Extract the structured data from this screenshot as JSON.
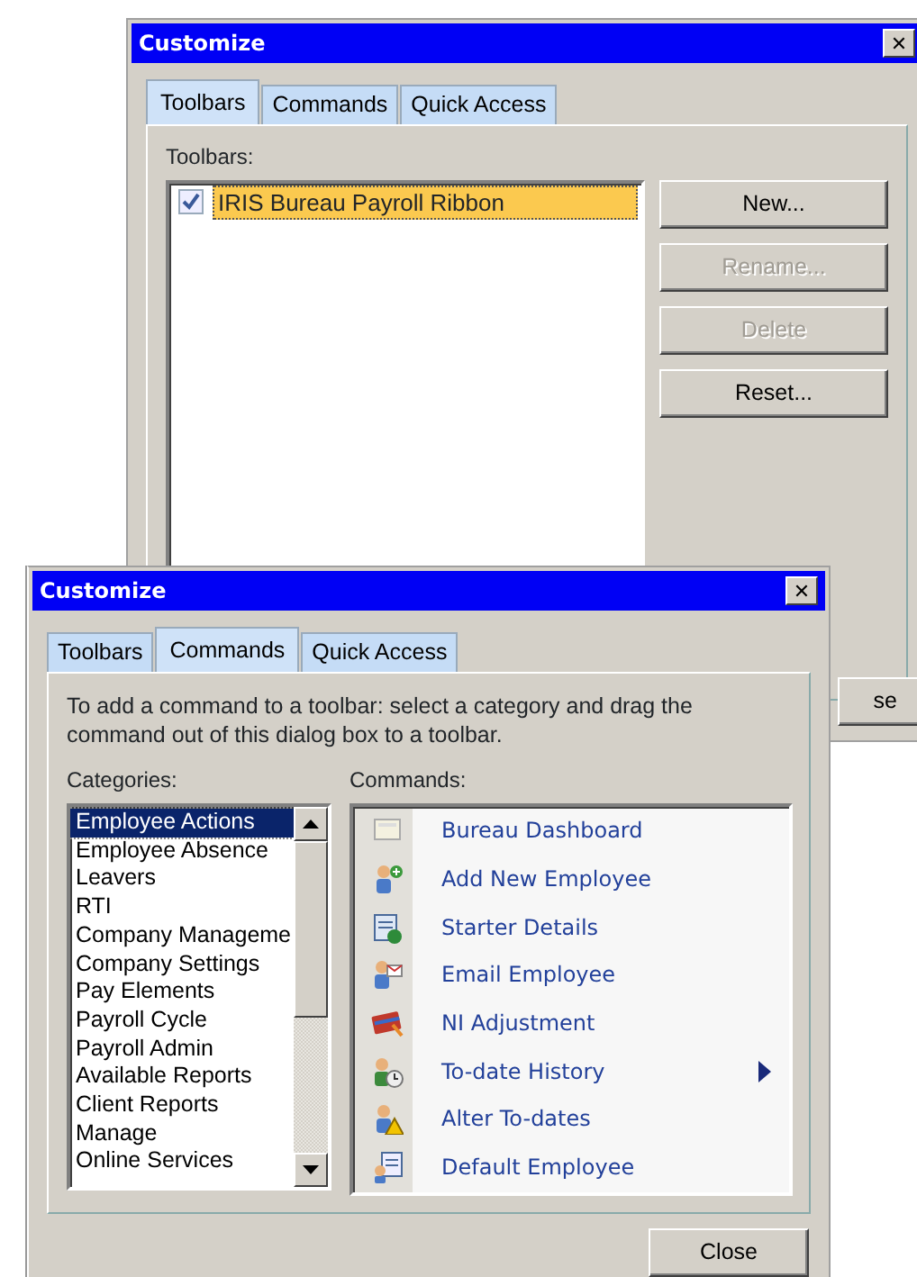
{
  "back_dialog": {
    "title": "Customize",
    "close": "✕",
    "tabs": [
      {
        "label": "Toolbars",
        "selected": true
      },
      {
        "label": "Commands",
        "selected": false
      },
      {
        "label": "Quick Access",
        "selected": false
      }
    ],
    "toolbars_label": "Toolbars:",
    "toolbars": [
      {
        "label": "IRIS Bureau Payroll Ribbon",
        "checked": true,
        "selected": true
      }
    ],
    "buttons": [
      {
        "label": "New...",
        "disabled": false
      },
      {
        "label": "Rename...",
        "disabled": true
      },
      {
        "label": "Delete",
        "disabled": true
      },
      {
        "label": "Reset...",
        "disabled": false
      }
    ],
    "close_button": "se"
  },
  "front_dialog": {
    "title": "Customize",
    "close": "✕",
    "tabs": [
      {
        "label": "Toolbars",
        "selected": false
      },
      {
        "label": "Commands",
        "selected": true
      },
      {
        "label": "Quick Access",
        "selected": false
      }
    ],
    "instructions": "To add a command to a toolbar: select a category and drag the command out of this dialog box to a toolbar.",
    "categories_label": "Categories:",
    "categories": [
      {
        "label": "Employee Actions",
        "selected": true
      },
      {
        "label": "Employee Absence",
        "selected": false
      },
      {
        "label": "Leavers",
        "selected": false
      },
      {
        "label": "RTI",
        "selected": false
      },
      {
        "label": "Company Manageme",
        "selected": false
      },
      {
        "label": "Company Settings",
        "selected": false
      },
      {
        "label": "Pay Elements",
        "selected": false
      },
      {
        "label": "Payroll Cycle",
        "selected": false
      },
      {
        "label": "Payroll Admin",
        "selected": false
      },
      {
        "label": "Available Reports",
        "selected": false
      },
      {
        "label": "Client Reports",
        "selected": false
      },
      {
        "label": "Manage",
        "selected": false
      },
      {
        "label": "Online Services",
        "selected": false
      }
    ],
    "commands_label": "Commands:",
    "commands": [
      {
        "label": "Bureau Dashboard",
        "submenu": false
      },
      {
        "label": "Add New Employee",
        "submenu": false
      },
      {
        "label": "Starter Details",
        "submenu": false
      },
      {
        "label": "Email Employee",
        "submenu": false
      },
      {
        "label": "NI Adjustment",
        "submenu": false
      },
      {
        "label": "To-date History",
        "submenu": true
      },
      {
        "label": "Alter To-dates",
        "submenu": false
      },
      {
        "label": "Default Employee",
        "submenu": false
      }
    ],
    "close_button": "Close"
  }
}
